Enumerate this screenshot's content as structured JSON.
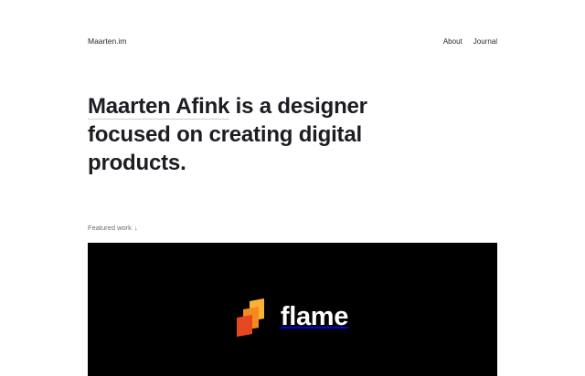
{
  "header": {
    "site_name": "Maarten.im",
    "nav": [
      {
        "label": "About"
      },
      {
        "label": "Journal"
      }
    ]
  },
  "hero": {
    "name": "Maarten Afink",
    "rest": " is a designer focused on creating digital products."
  },
  "featured": {
    "label": "Featured work",
    "arrow": "↓",
    "project_name": "flame",
    "logo_icon": "flame-logo-icon",
    "colors": {
      "card_background": "#000000",
      "logo_orange": "#f58a1f",
      "logo_red": "#e5481e",
      "logo_yellow": "#f9b233"
    }
  }
}
